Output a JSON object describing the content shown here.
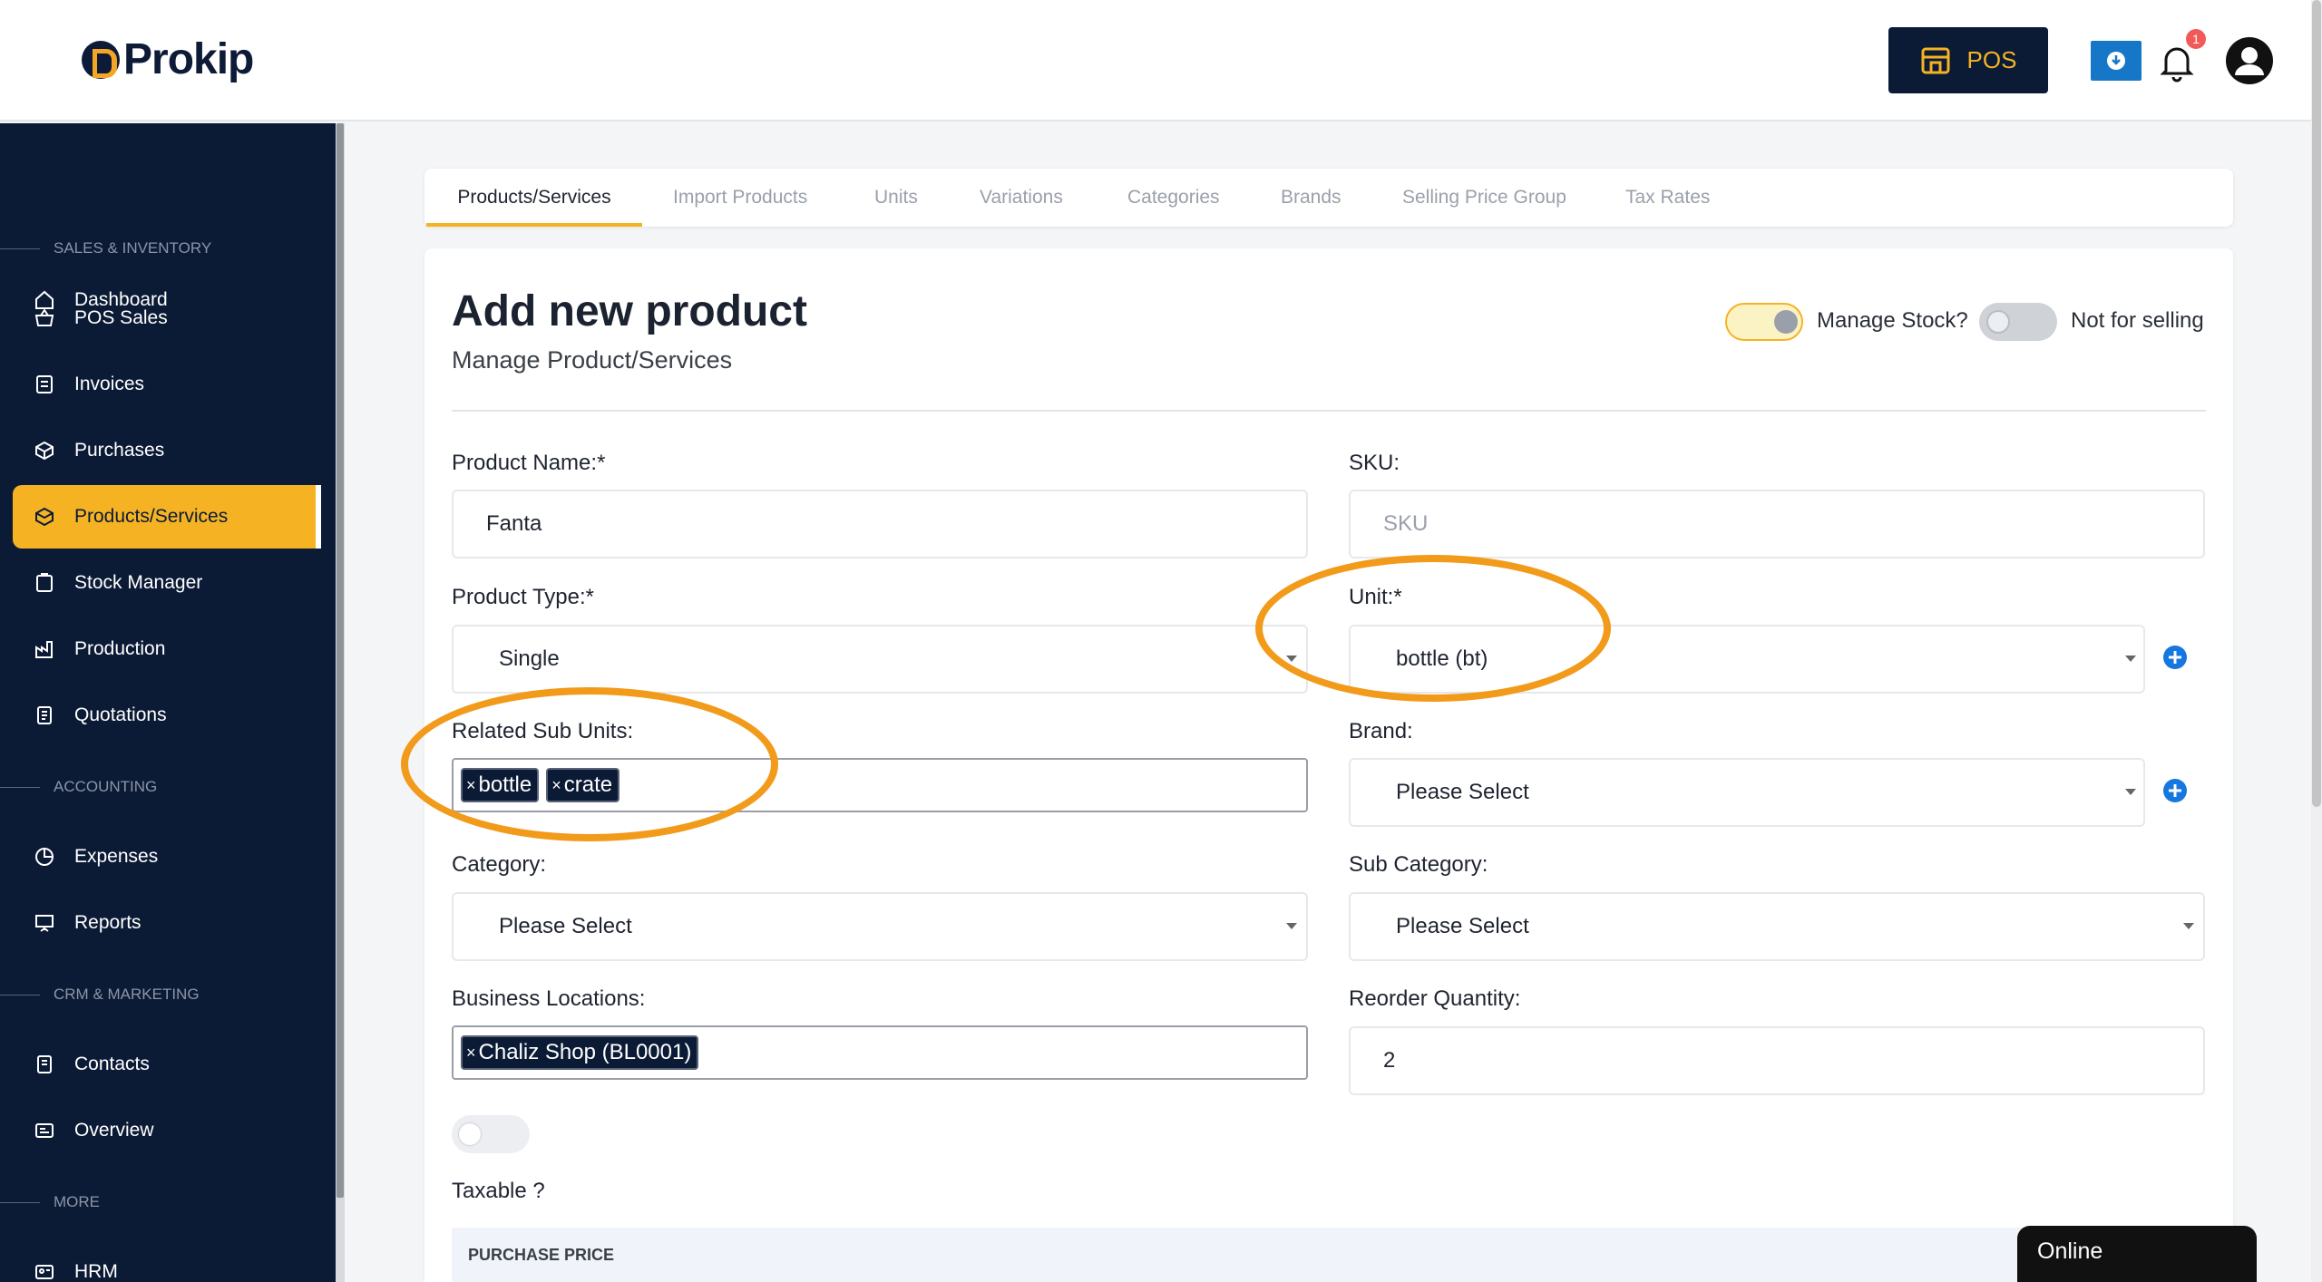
{
  "header": {
    "logo_text": "Prokip",
    "pos_button_label": "POS",
    "notification_count": "1"
  },
  "sidebar": {
    "items": [
      {
        "label": "Dashboard",
        "icon": "home-icon"
      },
      {
        "section": "SALES & INVENTORY"
      },
      {
        "label": "POS Sales",
        "icon": "basket-icon"
      },
      {
        "label": "Invoices",
        "icon": "invoice-icon"
      },
      {
        "label": "Purchases",
        "icon": "package-icon"
      },
      {
        "label": "Products/Services",
        "icon": "box-icon",
        "active": true
      },
      {
        "label": "Stock Manager",
        "icon": "clipboard-icon"
      },
      {
        "label": "Production",
        "icon": "factory-icon"
      },
      {
        "label": "Quotations",
        "icon": "document-icon"
      },
      {
        "section": "ACCOUNTING"
      },
      {
        "label": "Expenses",
        "icon": "pie-chart-icon"
      },
      {
        "label": "Reports",
        "icon": "presentation-icon"
      },
      {
        "section": "CRM & MARKETING"
      },
      {
        "label": "Contacts",
        "icon": "contacts-icon"
      },
      {
        "label": "Overview",
        "icon": "overview-icon"
      },
      {
        "section": "MORE"
      },
      {
        "label": "HRM",
        "icon": "id-card-icon"
      }
    ]
  },
  "tabs": [
    "Products/Services",
    "Import Products",
    "Units",
    "Variations",
    "Categories",
    "Brands",
    "Selling Price Group",
    "Tax Rates"
  ],
  "form": {
    "title": "Add new product",
    "subtitle": "Manage Product/Services",
    "manage_stock_label": "Manage Stock?",
    "manage_stock_on": true,
    "not_for_selling_label": "Not for selling",
    "not_for_selling_on": false,
    "product_name": {
      "label": "Product Name:*",
      "value": "Fanta"
    },
    "sku": {
      "label": "SKU:",
      "placeholder": "SKU"
    },
    "product_type": {
      "label": "Product Type:*",
      "value": "Single"
    },
    "unit": {
      "label": "Unit:*",
      "value": "bottle (bt)"
    },
    "related_sub_units": {
      "label": "Related Sub Units:",
      "chips": [
        "bottle",
        "crate"
      ]
    },
    "brand": {
      "label": "Brand:",
      "value": "Please Select"
    },
    "category": {
      "label": "Category:",
      "value": "Please Select"
    },
    "sub_category": {
      "label": "Sub Category:",
      "value": "Please Select"
    },
    "business_locations": {
      "label": "Business Locations:",
      "chips": [
        "Chaliz Shop (BL0001)"
      ]
    },
    "reorder_quantity": {
      "label": "Reorder Quantity:",
      "value": "2"
    },
    "taxable_label": "Taxable ?",
    "taxable_on": false,
    "purchase_price_heading": "PURCHASE PRICE"
  },
  "status": {
    "online_label": "Online"
  },
  "colors": {
    "sidebar_bg": "#0b1a35",
    "accent": "#f5b324",
    "highlight": "#f29a1a",
    "link_blue": "#1677c9"
  }
}
